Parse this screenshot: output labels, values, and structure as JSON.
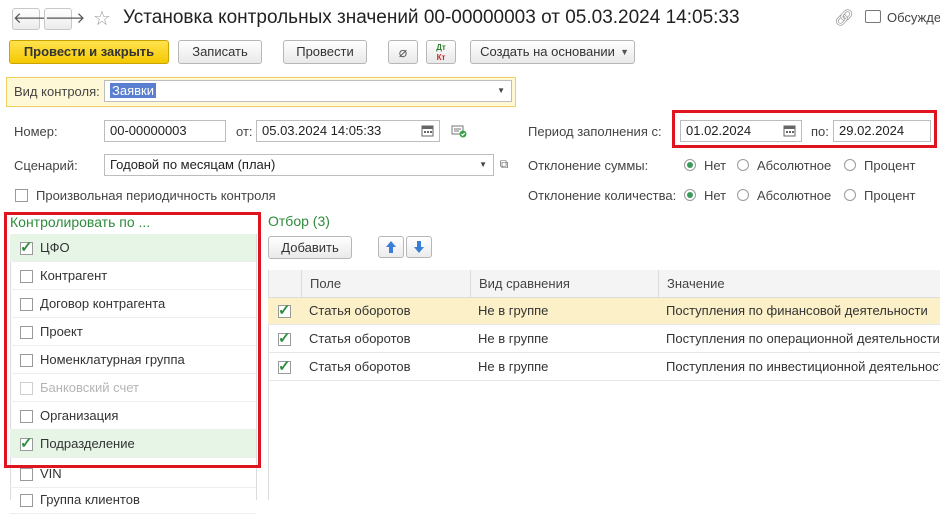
{
  "header": {
    "back_icon": "arrow-left-icon",
    "forward_icon": "arrow-right-icon",
    "star_icon": "star-icon",
    "title": "Установка контрольных значений 00-00000003 от 05.03.2024 14:05:33",
    "link_icon": "link-icon",
    "discuss_label": "Обсужде"
  },
  "toolbar": {
    "post_close": "Провести и закрыть",
    "save": "Записать",
    "post": "Провести",
    "dtkt_top": "Дт",
    "dtkt_bottom": "Кт",
    "create_based": "Создать на основании"
  },
  "form": {
    "control_type_label": "Вид контроля:",
    "control_type_value": "Заявки",
    "number_label": "Номер:",
    "number_value": "00-00000003",
    "from_label": "от:",
    "from_value": "05.03.2024 14:05:33",
    "period_label": "Период заполнения с:",
    "period_from": "01.02.2024",
    "period_to_label": "по:",
    "period_to": "29.02.2024",
    "scenario_label": "Сценарий:",
    "scenario_value": "Годовой по месяцам (план)",
    "sum_dev_label": "Отклонение суммы:",
    "qty_dev_label": "Отклонение количества:",
    "opt_none": "Нет",
    "opt_abs": "Абсолютное",
    "opt_pct": "Процент",
    "arbitrary_label": "Произвольная периодичность контроля"
  },
  "control_by": {
    "title": "Контролировать по ...",
    "items": [
      {
        "label": "ЦФО",
        "checked": true
      },
      {
        "label": "Контрагент",
        "checked": false
      },
      {
        "label": "Договор контрагента",
        "checked": false
      },
      {
        "label": "Проект",
        "checked": false
      },
      {
        "label": "Номенклатурная группа",
        "checked": false
      },
      {
        "label": "Банковский счет",
        "checked": false
      },
      {
        "label": "Организация",
        "checked": false
      },
      {
        "label": "Подразделение",
        "checked": true
      },
      {
        "label": "VIN",
        "checked": false
      },
      {
        "label": "Группа клиентов",
        "checked": false
      }
    ]
  },
  "filter": {
    "title": "Отбор (3)",
    "add_label": "Добавить",
    "columns": [
      "Поле",
      "Вид сравнения",
      "Значение"
    ],
    "rows": [
      {
        "field": "Статья оборотов",
        "comparison": "Не в группе",
        "value": "Поступления по финансовой деятельности",
        "checked": true
      },
      {
        "field": "Статья оборотов",
        "comparison": "Не в группе",
        "value": "Поступления по операционной деятельности",
        "checked": true
      },
      {
        "field": "Статья оборотов",
        "comparison": "Не в группе",
        "value": "Поступления по инвестиционной деятельности",
        "checked": true
      }
    ]
  },
  "colors": {
    "primary_button": "#f5c800",
    "accent_green": "#2f8f3f",
    "highlight_red": "#e0141e"
  }
}
